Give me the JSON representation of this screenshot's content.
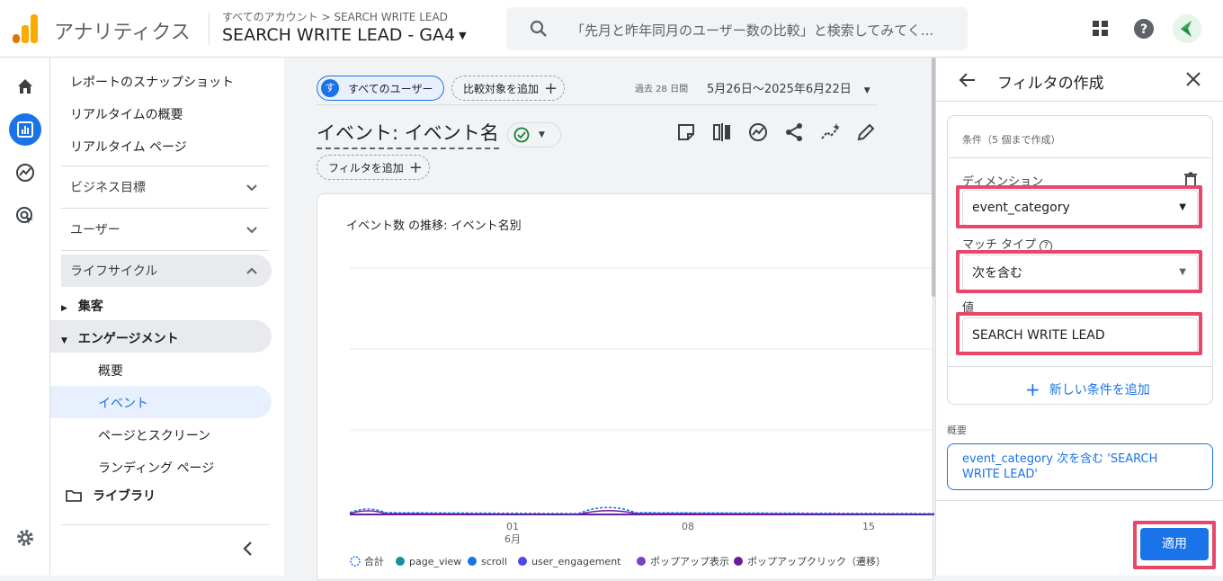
{
  "header": {
    "app_title": "アナリティクス",
    "breadcrumb": "すべてのアカウント > SEARCH WRITE LEAD",
    "property": "SEARCH WRITE LEAD - GA4",
    "search_placeholder": "「先月と昨年同月のユーザー数の比較」と検索してみてく..."
  },
  "sidenav": {
    "snapshot": "レポートのスナップショット",
    "realtime_overview": "リアルタイムの概要",
    "realtime_page": "リアルタイム ページ",
    "business_goals": "ビジネス目標",
    "users": "ユーザー",
    "lifecycle": "ライフサイクル",
    "acquisition": "集客",
    "engagement": "エンゲージメント",
    "overview": "概要",
    "events": "イベント",
    "pages_screens": "ページとスクリーン",
    "landing_page": "ランディング ページ",
    "library": "ライブラリ"
  },
  "main": {
    "all_users_badge": "す",
    "all_users": "すべてのユーザー",
    "add_comparison": "比較対象を追加",
    "date_prefix": "過去 28 日間",
    "date_range": "5月26日〜2025年6月22日",
    "report_title": "イベント: イベント名",
    "add_filter": "フィルタを追加",
    "chart_title": "イベント数 の推移: イベント名別"
  },
  "chart_data": {
    "type": "line",
    "title": "イベント数 の推移: イベント名別",
    "x_ticks": [
      "01",
      "08",
      "15"
    ],
    "x_tick_month": "6月",
    "series": [
      {
        "name": "合計",
        "color": "#1a73e8",
        "style": "dashed"
      },
      {
        "name": "page_view",
        "color": "#12939a"
      },
      {
        "name": "scroll",
        "color": "#1a73e8"
      },
      {
        "name": "user_engagement",
        "color": "#4b49e8"
      },
      {
        "name": "ポップアップ表示",
        "color": "#7b3fc8"
      },
      {
        "name": "ポップアップクリック（遷移）",
        "color": "#6a1b9a"
      }
    ],
    "grid": true
  },
  "panel": {
    "title": "フィルタの作成",
    "conditions_note": "条件（5 個まで作成）",
    "dimension_label": "ディメンション",
    "dimension_value": "event_category",
    "match_type_label": "マッチ タイプ",
    "match_type_value": "次を含む",
    "value_label": "値",
    "value_value": "SEARCH WRITE LEAD",
    "add_condition": "新しい条件を追加",
    "summary_label": "概要",
    "summary_text": "event_category 次を含む 'SEARCH WRITE LEAD'",
    "apply": "適用"
  },
  "colors": {
    "accent": "#1a73e8",
    "highlight": "#e8476a",
    "logo_orange": "#f9ab00",
    "logo_dark": "#e37400"
  }
}
